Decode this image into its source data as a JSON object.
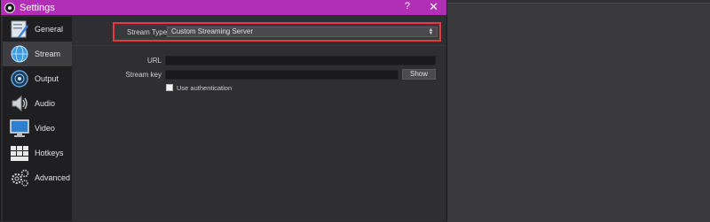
{
  "window": {
    "title": "Settings",
    "help_glyph": "?",
    "close_glyph": "✕"
  },
  "sidebar": {
    "items": [
      {
        "label": "General",
        "icon": "general-icon",
        "active": false
      },
      {
        "label": "Stream",
        "icon": "globe-icon",
        "active": true
      },
      {
        "label": "Output",
        "icon": "output-icon",
        "active": false
      },
      {
        "label": "Audio",
        "icon": "speaker-icon",
        "active": false
      },
      {
        "label": "Video",
        "icon": "monitor-icon",
        "active": false
      },
      {
        "label": "Hotkeys",
        "icon": "keyboard-icon",
        "active": false
      },
      {
        "label": "Advanced",
        "icon": "gears-icon",
        "active": false
      }
    ]
  },
  "stream": {
    "type_label": "Stream Type",
    "type_value": "Custom Streaming Server",
    "url_label": "URL",
    "url_value": "",
    "key_label": "Stream key",
    "key_value": "",
    "show_button": "Show",
    "auth_label": "Use authentication",
    "auth_checked": false
  },
  "colors": {
    "titlebar": "#b12fb6",
    "highlight_border": "#e8393e",
    "sidebar_bg": "#1f1e21",
    "active_item_bg": "#3e3d41"
  }
}
